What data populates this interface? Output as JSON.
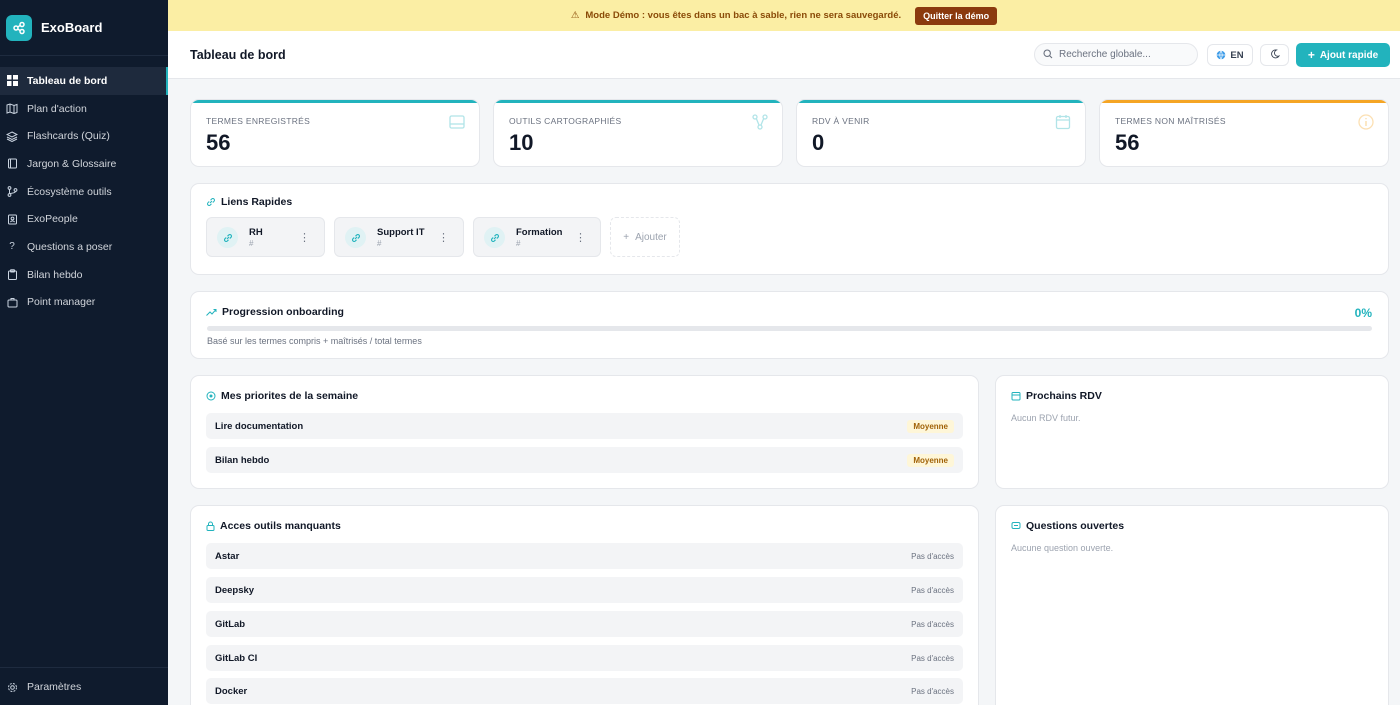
{
  "brand": {
    "name": "ExoBoard"
  },
  "sidebar": {
    "items": [
      {
        "label": "Tableau de bord",
        "active": true
      },
      {
        "label": "Plan d'action"
      },
      {
        "label": "Flashcards (Quiz)"
      },
      {
        "label": "Jargon & Glossaire"
      },
      {
        "label": "Écosystème outils"
      },
      {
        "label": "ExoPeople"
      },
      {
        "label": "Questions a poser"
      },
      {
        "label": "Bilan hebdo"
      },
      {
        "label": "Point manager"
      }
    ],
    "footer": {
      "label": "Paramètres"
    }
  },
  "banner": {
    "text": "Mode Démo : vous êtes dans un bac à sable, rien ne sera sauvegardé.",
    "button": "Quitter la démo"
  },
  "header": {
    "title": "Tableau de bord",
    "search_placeholder": "Recherche globale...",
    "lang": "EN",
    "quick_add": "Ajout rapide"
  },
  "stats": [
    {
      "label": "TERMES ENREGISTRÉS",
      "value": "56",
      "accent": "#22b3bd"
    },
    {
      "label": "OUTILS CARTOGRAPHIÉS",
      "value": "10",
      "accent": "#22b3bd"
    },
    {
      "label": "RDV À VENIR",
      "value": "0",
      "accent": "#22b3bd"
    },
    {
      "label": "TERMES NON MAÎTRISÉS",
      "value": "56",
      "accent": "#f5a524"
    }
  ],
  "quick_links": {
    "title": "Liens Rapides",
    "items": [
      {
        "name": "RH",
        "url": "#"
      },
      {
        "name": "Support IT",
        "url": "#"
      },
      {
        "name": "Formation",
        "url": "#"
      }
    ],
    "add_label": "Ajouter"
  },
  "progress": {
    "title": "Progression onboarding",
    "percent_label": "0%",
    "percent": 0,
    "note": "Basé sur les termes compris + maîtrisés / total termes"
  },
  "priorities": {
    "title": "Mes priorites de la semaine",
    "items": [
      {
        "label": "Lire documentation",
        "badge": "Moyenne"
      },
      {
        "label": "Bilan hebdo",
        "badge": "Moyenne"
      }
    ]
  },
  "rdv": {
    "title": "Prochains RDV",
    "empty": "Aucun RDV futur."
  },
  "missing_tools": {
    "title": "Acces outils manquants",
    "items": [
      {
        "label": "Astar",
        "status": "Pas d'accès"
      },
      {
        "label": "Deepsky",
        "status": "Pas d'accès"
      },
      {
        "label": "GitLab",
        "status": "Pas d'accès"
      },
      {
        "label": "GitLab CI",
        "status": "Pas d'accès"
      },
      {
        "label": "Docker",
        "status": "Pas d'accès"
      }
    ]
  },
  "questions": {
    "title": "Questions ouvertes",
    "empty": "Aucune question ouverte."
  },
  "colors": {
    "accent": "#22b3bd",
    "sidebar_bg": "#0f1b2d",
    "banner_bg": "#fbeea4",
    "warning": "#f5a524"
  }
}
